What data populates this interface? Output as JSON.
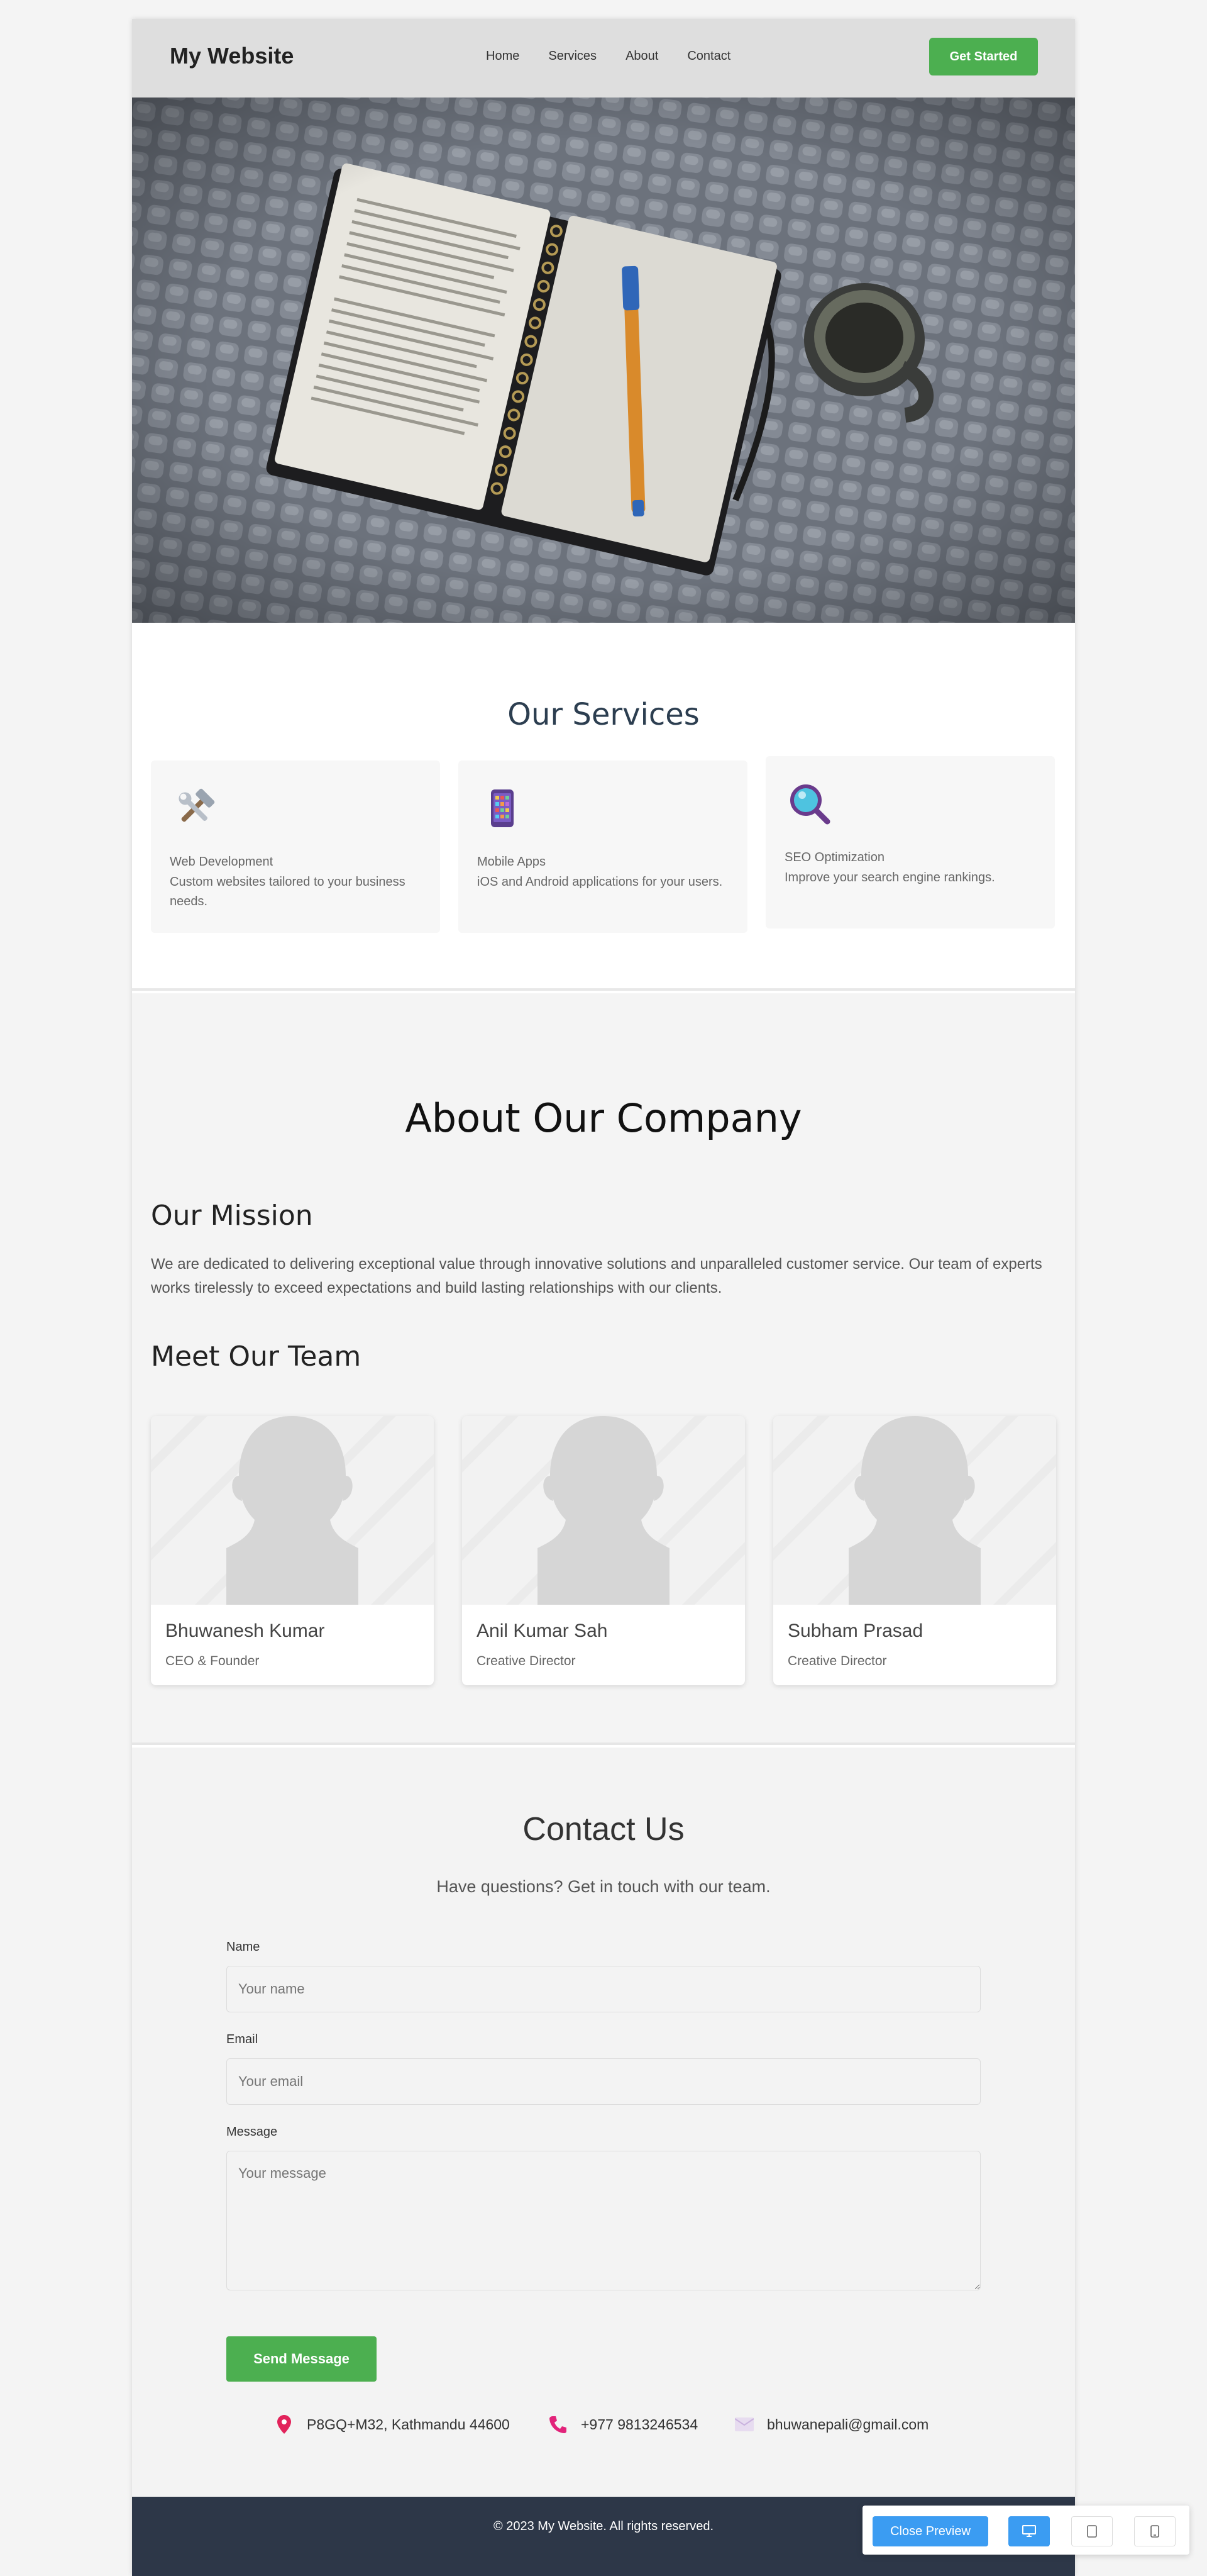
{
  "header": {
    "brand": "My Website",
    "nav": [
      "Home",
      "Services",
      "About",
      "Contact"
    ],
    "cta": "Get Started"
  },
  "services": {
    "title": "Our Services",
    "items": [
      {
        "icon": "hammer-wrench-icon",
        "title": "Web Development",
        "desc": "Custom websites tailored to your business needs."
      },
      {
        "icon": "mobile-phone-icon",
        "title": "Mobile Apps",
        "desc": "iOS and Android applications for your users."
      },
      {
        "icon": "magnifying-glass-icon",
        "title": "SEO Optimization",
        "desc": "Improve your search engine rankings."
      }
    ]
  },
  "about": {
    "title": "About Our Company",
    "mission_title": "Our Mission",
    "mission_text": "We are dedicated to delivering exceptional value through innovative solutions and unparalleled customer service. Our team of experts works tirelessly to exceed expectations and build lasting relationships with our clients.",
    "team_title": "Meet Our Team",
    "team": [
      {
        "name": "Bhuwanesh Kumar",
        "role": "CEO & Founder"
      },
      {
        "name": "Anil Kumar Sah",
        "role": "Creative Director"
      },
      {
        "name": "Subham Prasad",
        "role": "Creative Director"
      }
    ]
  },
  "contact": {
    "title": "Contact Us",
    "subtitle": "Have questions? Get in touch with our team.",
    "name_label": "Name",
    "name_placeholder": "Your name",
    "email_label": "Email",
    "email_placeholder": "Your email",
    "message_label": "Message",
    "message_placeholder": "Your message",
    "send": "Send Message",
    "address": "P8GQ+M32, Kathmandu 44600",
    "phone": "+977 9813246534",
    "email": "bhuwanepali@gmail.com"
  },
  "footer": {
    "text": "© 2023 My Website. All rights reserved."
  },
  "toolbar": {
    "close": "Close Preview"
  },
  "colors": {
    "accent_green": "#4caf50",
    "footer_bg": "#2d3748",
    "toolbar_blue": "#3b9cf2"
  }
}
